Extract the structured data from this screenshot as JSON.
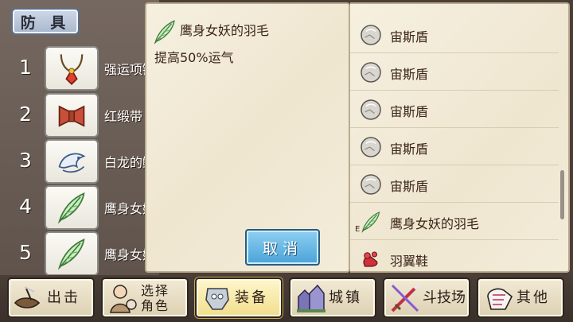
{
  "section_tab": {
    "label": "防 具"
  },
  "equipment_slots": [
    {
      "number": "1",
      "name": "强运项链",
      "icon": "amulet-icon"
    },
    {
      "number": "2",
      "name": "红缎带",
      "icon": "red-ribbon-icon"
    },
    {
      "number": "3",
      "name": "白龙的鳞",
      "icon": "white-dragon-icon"
    },
    {
      "number": "4",
      "name": "鹰身女妖的羽毛",
      "icon": "feather-icon"
    },
    {
      "number": "5",
      "name": "鹰身女妖的羽毛",
      "icon": "feather-icon"
    }
  ],
  "detail": {
    "title": "鹰身女妖的羽毛",
    "description": "提高50%运气",
    "icon": "feather-icon",
    "cancel_label": "取消"
  },
  "item_list": [
    {
      "label": "宙斯盾",
      "icon": "shield-icon",
      "equipped_mark": ""
    },
    {
      "label": "宙斯盾",
      "icon": "shield-icon",
      "equipped_mark": ""
    },
    {
      "label": "宙斯盾",
      "icon": "shield-icon",
      "equipped_mark": ""
    },
    {
      "label": "宙斯盾",
      "icon": "shield-icon",
      "equipped_mark": ""
    },
    {
      "label": "宙斯盾",
      "icon": "shield-icon",
      "equipped_mark": ""
    },
    {
      "label": "鹰身女妖的羽毛",
      "icon": "feather-icon",
      "equipped_mark": "E"
    },
    {
      "label": "羽翼鞋",
      "icon": "winged-shoes-icon",
      "equipped_mark": ""
    }
  ],
  "nav": {
    "sortie": "出击",
    "select_character_1": "选择",
    "select_character_2": "角色",
    "equipment": "装备",
    "town": "城镇",
    "arena": "斗技场",
    "other": "其他"
  },
  "colors": {
    "parchment": "#f3ecd9",
    "cancel_button": "#4aa2d8",
    "active_nav": "#f1de8c"
  }
}
